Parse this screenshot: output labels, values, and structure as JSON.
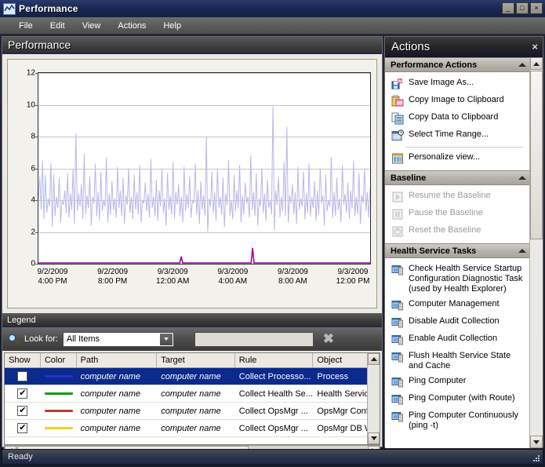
{
  "window": {
    "title": "Performance",
    "icon": "performance-chart-icon",
    "minimize_label": "_",
    "maximize_label": "□",
    "close_label": "×"
  },
  "menu": {
    "items": [
      {
        "label": "File"
      },
      {
        "label": "Edit"
      },
      {
        "label": "View"
      },
      {
        "label": "Actions"
      },
      {
        "label": "Help"
      }
    ]
  },
  "performance": {
    "header_title": "Performance"
  },
  "chart_data": {
    "type": "line",
    "title": "Performance",
    "xlabel": "",
    "ylabel": "",
    "ylim": [
      0,
      12
    ],
    "yticks": [
      0,
      2,
      4,
      6,
      8,
      10,
      12
    ],
    "ytick_labels": [
      "0",
      "2",
      "4",
      "6",
      "8",
      "10",
      "12"
    ],
    "grid": true,
    "legend_position": "below-chart-table",
    "x_tick_labels": [
      {
        "date": "9/2/2009",
        "time": "4:00 PM"
      },
      {
        "date": "9/2/2009",
        "time": "8:00 PM"
      },
      {
        "date": "9/3/2009",
        "time": "12:00 AM"
      },
      {
        "date": "9/3/2009",
        "time": "4:00 AM"
      },
      {
        "date": "9/3/2009",
        "time": "8:00 AM"
      },
      {
        "date": "9/3/2009",
        "time": "12:00 PM"
      }
    ],
    "series": [
      {
        "name": "Process",
        "color": "#b8b8ea",
        "values": [
          4.0,
          5.5,
          3.4,
          6.5,
          2.8,
          5.6,
          3.2,
          4.1,
          3.6,
          6.3,
          2.3,
          5.6,
          3.0,
          4.2,
          3.5,
          5.4,
          2.6,
          4.0,
          3.7,
          4.6,
          3.2,
          5.7,
          2.9,
          4.4,
          3.4,
          6.0,
          2.5,
          8.2,
          3.3,
          4.4,
          3.6,
          5.0,
          2.8,
          6.9,
          3.1,
          4.3,
          3.5,
          5.5,
          2.4,
          4.2,
          3.8,
          6.3,
          3.0,
          4.5,
          2.7,
          5.8,
          3.3,
          4.0,
          3.6,
          6.7,
          2.6,
          4.4,
          3.1,
          5.2,
          3.4,
          4.1,
          2.9,
          6.1,
          3.5,
          4.6,
          3.0,
          5.4,
          2.5,
          4.3,
          3.7,
          6.0,
          3.2,
          4.2,
          2.8,
          5.6,
          3.4,
          4.5,
          3.1,
          6.2,
          2.6,
          4.0,
          3.8,
          5.1,
          3.3,
          4.4,
          2.9,
          6.6,
          3.5,
          4.2,
          3.0,
          5.3,
          2.7,
          4.6,
          3.6,
          6.0,
          3.2,
          4.1,
          2.4,
          5.7,
          3.4,
          4.3,
          3.1,
          6.4,
          2.8,
          4.5,
          3.7,
          5.0,
          3.0,
          4.2,
          2.6,
          6.1,
          3.3,
          4.4,
          3.5,
          5.5,
          2.9,
          4.0,
          3.8,
          6.3,
          3.1,
          4.6,
          2.5,
          5.2,
          3.4,
          4.3,
          3.0,
          8.0,
          2.0,
          4.1,
          3.6,
          5.8,
          3.2,
          4.5,
          2.7,
          6.0,
          3.5,
          4.2,
          3.1,
          5.4,
          2.3,
          4.4,
          3.7,
          6.5,
          3.0,
          4.0,
          2.8,
          5.6,
          3.3,
          4.6,
          3.5,
          6.2,
          2.6,
          4.3,
          3.1,
          5.1,
          3.8,
          4.2,
          2.9,
          6.8,
          3.4,
          4.5,
          3.0,
          5.7,
          2.4,
          4.1,
          3.6,
          6.0,
          3.2,
          4.4,
          2.7,
          5.3,
          3.5,
          4.0,
          3.1,
          10.0,
          2.1,
          4.6,
          3.7,
          5.5,
          2.9,
          4.2,
          3.3,
          6.4,
          3.0,
          8.6,
          2.6,
          4.3,
          3.8,
          5.0,
          3.1,
          4.5,
          2.5,
          6.1,
          3.4,
          4.1,
          3.6,
          5.8,
          2.8,
          4.4,
          3.2,
          6.3,
          3.0,
          4.2,
          3.5,
          5.2,
          2.7,
          4.6,
          3.1,
          6.0,
          3.8,
          4.3,
          2.4,
          5.6,
          3.3,
          4.0,
          3.6,
          6.7,
          2.9,
          4.5,
          3.0,
          5.4,
          3.4,
          4.1,
          2.6,
          6.2,
          3.7,
          4.4,
          3.2,
          5.1,
          2.8,
          4.6,
          3.5,
          6.5,
          3.0,
          4.2,
          3.1,
          5.7,
          2.5,
          4.3,
          3.8,
          6.0,
          3.3,
          4.5,
          2.9,
          4.8
        ]
      },
      {
        "name": "Baseline",
        "color": "#a800a8",
        "values": [
          0.05,
          0.05,
          0.05,
          0.05,
          0.05,
          0.05,
          0.05,
          0.05,
          0.05,
          0.05,
          0.05,
          0.05,
          0.05,
          0.05,
          0.05,
          0.05,
          0.05,
          0.05,
          0.05,
          0.05,
          0.05,
          0.05,
          0.05,
          0.05,
          0.05,
          0.05,
          0.05,
          0.05,
          0.05,
          0.05,
          0.05,
          0.05,
          0.05,
          0.05,
          0.05,
          0.05,
          0.05,
          0.05,
          0.05,
          0.05,
          0.05,
          0.05,
          0.05,
          0.05,
          0.05,
          0.05,
          0.05,
          0.05,
          0.05,
          0.05,
          0.05,
          0.05,
          0.05,
          0.05,
          0.05,
          0.05,
          0.05,
          0.05,
          0.05,
          0.05,
          0.05,
          0.05,
          0.05,
          0.05,
          0.05,
          0.05,
          0.05,
          0.05,
          0.05,
          0.05,
          0.05,
          0.05,
          0.05,
          0.05,
          0.05,
          0.05,
          0.05,
          0.05,
          0.05,
          0.05,
          0.05,
          0.05,
          0.05,
          0.05,
          0.05,
          0.05,
          0.05,
          0.05,
          0.05,
          0.05,
          0.05,
          0.05,
          0.05,
          0.05,
          0.05,
          0.05,
          0.45,
          0.05,
          0.05,
          0.05,
          0.05,
          0.05,
          0.05,
          0.05,
          0.05,
          0.05,
          0.05,
          0.05,
          0.05,
          0.05,
          0.05,
          0.05,
          0.05,
          0.05,
          0.05,
          0.05,
          0.05,
          0.05,
          0.05,
          0.05,
          0.05,
          0.05,
          0.05,
          0.05,
          0.05,
          0.05,
          0.05,
          0.05,
          0.05,
          0.05,
          0.05,
          0.05,
          0.05,
          0.05,
          0.05,
          0.05,
          0.05,
          0.05,
          0.05,
          0.05,
          0.05,
          0.05,
          0.05,
          0.05,
          1.0,
          0.05,
          0.05,
          0.05,
          0.05,
          0.05,
          0.05,
          0.05,
          0.05,
          0.05,
          0.05,
          0.05,
          0.05,
          0.05,
          0.05,
          0.05,
          0.05,
          0.05,
          0.05,
          0.05,
          0.05,
          0.05,
          0.05,
          0.05,
          0.05,
          0.05,
          0.05,
          0.05,
          0.05,
          0.05,
          0.05,
          0.05,
          0.05,
          0.05,
          0.05,
          0.05,
          0.05,
          0.05,
          0.05,
          0.05,
          0.05,
          0.05,
          0.05,
          0.05,
          0.05,
          0.05,
          0.05,
          0.05,
          0.05,
          0.05,
          0.05,
          0.05,
          0.05,
          0.05,
          0.05,
          0.05,
          0.05,
          0.05,
          0.05,
          0.05,
          0.05,
          0.05,
          0.05,
          0.05,
          0.05,
          0.05,
          0.05,
          0.05,
          0.05,
          0.05,
          0.05,
          0.05,
          0.05,
          0.05,
          0.05,
          0.05,
          0.05,
          0.05,
          0.05,
          0.05
        ]
      }
    ]
  },
  "legend": {
    "section_title": "Legend",
    "look_for_label": "Look for:",
    "filter_selected": "All Items",
    "search_value": "",
    "search_placeholder": "",
    "clear_label": "✖",
    "columns": [
      "Show",
      "Color",
      "Path",
      "Target",
      "Rule",
      "Object"
    ],
    "rows": [
      {
        "checked": false,
        "selected": true,
        "color": "#2b2bd4",
        "path": "computer name",
        "target": "computer name",
        "rule": "Collect Processo...",
        "object": "Process"
      },
      {
        "checked": true,
        "selected": false,
        "color": "#0f9b0f",
        "path": "computer name",
        "target": "computer name",
        "rule": "Collect Health Se...",
        "object": "Health Service"
      },
      {
        "checked": true,
        "selected": false,
        "color": "#c03a32",
        "path": "computer name",
        "target": "computer name",
        "rule": "Collect OpsMgr ...",
        "object": "OpsMgr Config S"
      },
      {
        "checked": true,
        "selected": false,
        "color": "#f5d020",
        "path": "computer name",
        "target": "computer name",
        "rule": "Collect OpsMgr ...",
        "object": "OpsMgr DB Writ."
      }
    ],
    "checkmark": "✔"
  },
  "actions_pane": {
    "title": "Actions",
    "close_label": "×",
    "groups": [
      {
        "title": "Performance Actions",
        "items": [
          {
            "label": "Save Image As...",
            "icon": "save-image-icon",
            "disabled": false
          },
          {
            "label": "Copy Image to Clipboard",
            "icon": "copy-image-icon",
            "disabled": false
          },
          {
            "label": "Copy Data to Clipboard",
            "icon": "copy-data-icon",
            "disabled": false
          },
          {
            "label": "Select Time Range...",
            "icon": "calendar-clock-icon",
            "disabled": false
          },
          {
            "separator": true
          },
          {
            "label": "Personalize view...",
            "icon": "personalize-view-icon",
            "disabled": false
          }
        ]
      },
      {
        "title": "Baseline",
        "items": [
          {
            "label": "Resume the Baseline",
            "icon": "play-icon",
            "disabled": true
          },
          {
            "label": "Pause the Baseline",
            "icon": "pause-icon",
            "disabled": true
          },
          {
            "label": "Reset the Baseline",
            "icon": "power-reset-icon",
            "disabled": true
          }
        ]
      },
      {
        "title": "Health Service Tasks",
        "items": [
          {
            "label": "Check Health Service Startup Configuration Diagnostic Task (used by Health Explorer)",
            "icon": "computer-task-icon",
            "disabled": false
          },
          {
            "label": "Computer Management",
            "icon": "computer-task-icon",
            "disabled": false
          },
          {
            "label": "Disable Audit Collection",
            "icon": "computer-task-icon",
            "disabled": false
          },
          {
            "label": "Enable Audit Collection",
            "icon": "computer-task-icon",
            "disabled": false
          },
          {
            "label": "Flush Health Service State and Cache",
            "icon": "computer-task-icon",
            "disabled": false
          },
          {
            "label": "Ping Computer",
            "icon": "computer-task-icon",
            "disabled": false
          },
          {
            "label": "Ping Computer (with Route)",
            "icon": "computer-task-icon",
            "disabled": false
          },
          {
            "label": "Ping Computer Continuously (ping -t)",
            "icon": "computer-task-icon",
            "disabled": false
          }
        ]
      }
    ]
  },
  "statusbar": {
    "text": "Ready"
  }
}
